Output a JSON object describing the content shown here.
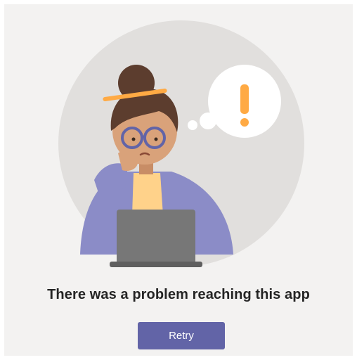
{
  "error": {
    "message": "There was a problem reaching this app",
    "retry_label": "Retry"
  },
  "illustration": {
    "description_icon": "person-thinking-laptop-illustration",
    "alert_icon": "exclamation-icon"
  },
  "colors": {
    "background": "#f3f2f1",
    "circle": "#e1dfdd",
    "button": "#6264a7",
    "button_text": "#ffffff",
    "sweater": "#8b8cc7",
    "exclamation": "#ffaa44",
    "laptop": "#777777",
    "hair": "#5c3d2e",
    "skin": "#d9a27a"
  }
}
